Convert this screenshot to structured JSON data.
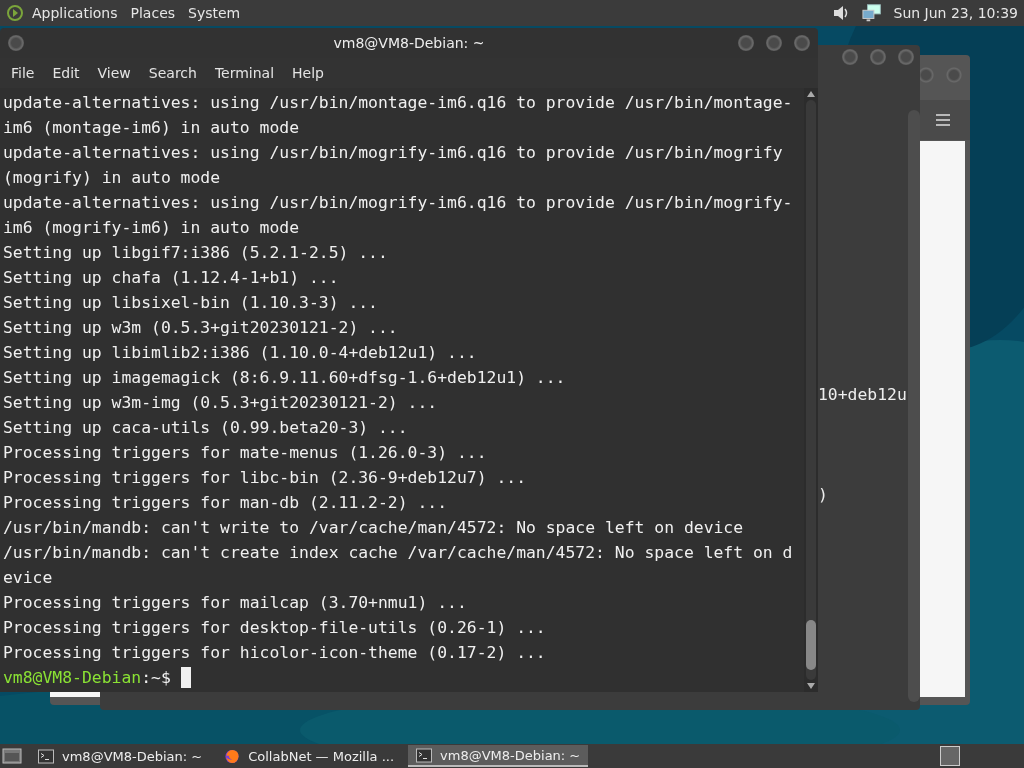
{
  "top_panel": {
    "menus": [
      "Applications",
      "Places",
      "System"
    ],
    "clock": "Sun Jun 23, 10:39"
  },
  "background_window": {
    "visible_text": [
      "10+deb12u",
      ")"
    ]
  },
  "terminal": {
    "title": "vm8@VM8-Debian: ~",
    "menu": [
      "File",
      "Edit",
      "View",
      "Search",
      "Terminal",
      "Help"
    ],
    "lines": [
      "update-alternatives: using /usr/bin/montage-im6.q16 to provide /usr/bin/montage-",
      "im6 (montage-im6) in auto mode",
      "update-alternatives: using /usr/bin/mogrify-im6.q16 to provide /usr/bin/mogrify",
      "(mogrify) in auto mode",
      "update-alternatives: using /usr/bin/mogrify-im6.q16 to provide /usr/bin/mogrify-",
      "im6 (mogrify-im6) in auto mode",
      "Setting up libgif7:i386 (5.2.1-2.5) ...",
      "Setting up chafa (1.12.4-1+b1) ...",
      "Setting up libsixel-bin (1.10.3-3) ...",
      "Setting up w3m (0.5.3+git20230121-2) ...",
      "Setting up libimlib2:i386 (1.10.0-4+deb12u1) ...",
      "Setting up imagemagick (8:6.9.11.60+dfsg-1.6+deb12u1) ...",
      "Setting up w3m-img (0.5.3+git20230121-2) ...",
      "Setting up caca-utils (0.99.beta20-3) ...",
      "Processing triggers for mate-menus (1.26.0-3) ...",
      "Processing triggers for libc-bin (2.36-9+deb12u7) ...",
      "Processing triggers for man-db (2.11.2-2) ...",
      "/usr/bin/mandb: can't write to /var/cache/man/4572: No space left on device",
      "/usr/bin/mandb: can't create index cache /var/cache/man/4572: No space left on d",
      "evice",
      "Processing triggers for mailcap (3.70+nmu1) ...",
      "Processing triggers for desktop-file-utils (0.26-1) ...",
      "Processing triggers for hicolor-icon-theme (0.17-2) ..."
    ],
    "prompt": {
      "user_host": "vm8@VM8-Debian",
      "path": ":~$"
    }
  },
  "taskbar": {
    "tasks": [
      {
        "label": "vm8@VM8-Debian: ~",
        "kind": "terminal",
        "selected": false
      },
      {
        "label": "CollabNet — Mozilla ...",
        "kind": "browser",
        "selected": false
      },
      {
        "label": "vm8@VM8-Debian: ~",
        "kind": "terminal",
        "selected": true
      }
    ]
  }
}
